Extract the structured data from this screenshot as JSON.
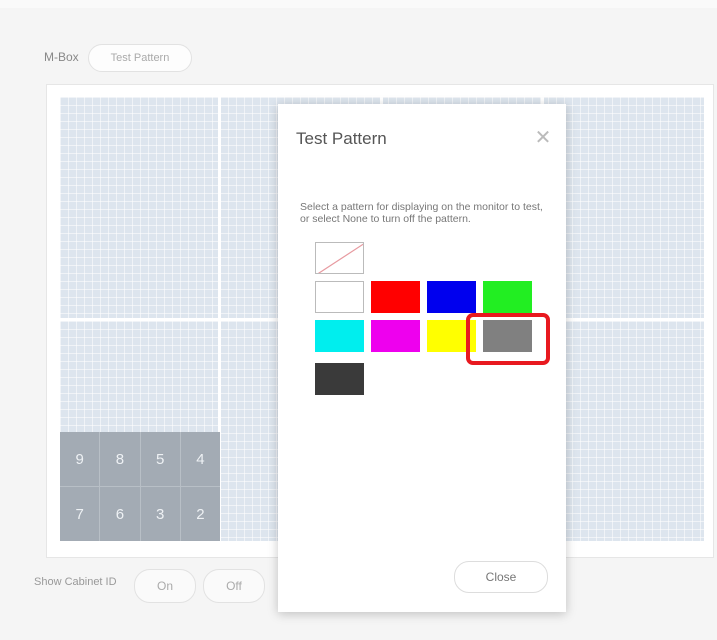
{
  "breadcrumb": {
    "root": "M-Box",
    "current": "Test Pattern"
  },
  "cabinets": {
    "top": [
      "9",
      "8",
      "5",
      "4"
    ],
    "bottom": [
      "7",
      "6",
      "3",
      "2"
    ]
  },
  "cabinet_id": {
    "label": "Show Cabinet ID",
    "on": "On",
    "off": "Off"
  },
  "modal": {
    "title": "Test Pattern",
    "description": "Select a pattern for displaying on the monitor to test, or select None to turn off the pattern.",
    "close_label": "Close",
    "selected_pattern": "gray",
    "patterns": [
      {
        "name": "none",
        "color": ""
      },
      {
        "name": "white",
        "color": "#ffffff"
      },
      {
        "name": "red",
        "color": "#ff0000"
      },
      {
        "name": "blue",
        "color": "#0000ee"
      },
      {
        "name": "green",
        "color": "#22ee22"
      },
      {
        "name": "cyan",
        "color": "#00eeee"
      },
      {
        "name": "magenta",
        "color": "#ee00ee"
      },
      {
        "name": "yellow",
        "color": "#ffff00"
      },
      {
        "name": "gray",
        "color": "#808080"
      },
      {
        "name": "dark-gray",
        "color": "#3a3a3a"
      }
    ]
  }
}
